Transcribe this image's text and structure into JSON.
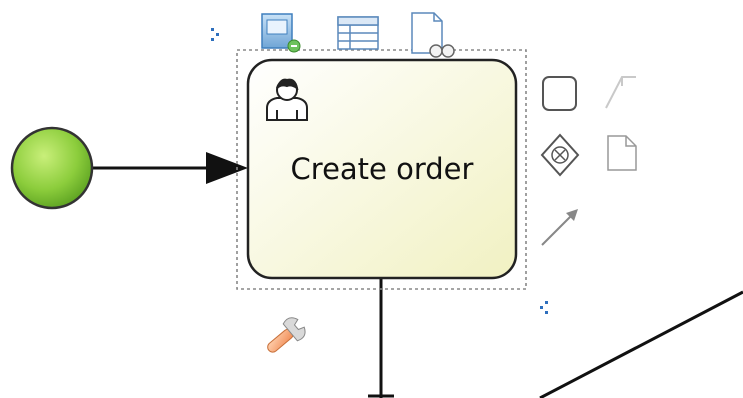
{
  "diagram": {
    "start_event": {
      "fill_start": "#a8d84a",
      "fill_end": "#5ea823",
      "stroke": "#333333"
    },
    "task": {
      "label": "Create order",
      "type": "user-task",
      "fill": "#f8f8d2",
      "stroke": "#222222"
    },
    "selection": {
      "color": "#888888",
      "handle_color": "#2e6fbd"
    },
    "context_pad": {
      "top_icons": [
        "form-icon",
        "table-icon",
        "search-document-icon"
      ],
      "side_icons": [
        "task-shape-icon",
        "text-annotation-icon",
        "gateway-icon",
        "data-object-icon",
        "connect-arrow-icon"
      ],
      "bottom_icons": [
        "wrench-icon"
      ]
    }
  }
}
